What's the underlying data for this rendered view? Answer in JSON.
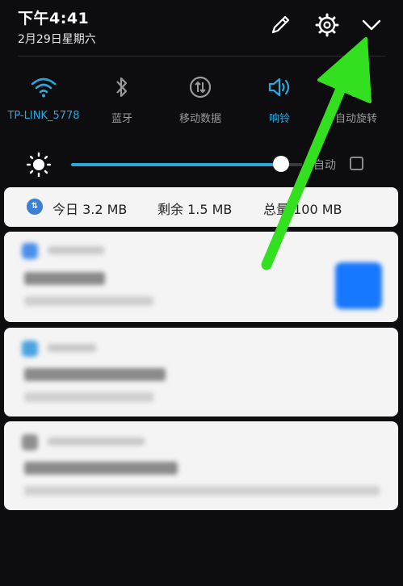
{
  "status": {
    "time": "下午4:41",
    "date": "2月29日星期六"
  },
  "header_icons": [
    "edit-icon",
    "settings-icon",
    "collapse-icon"
  ],
  "toggles": [
    {
      "label": "TP-LINK_5778",
      "icon": "wifi-icon",
      "state": "on"
    },
    {
      "label": "蓝牙",
      "icon": "bluetooth-icon",
      "state": "off"
    },
    {
      "label": "移动数据",
      "icon": "mobile-data-icon",
      "state": "off"
    },
    {
      "label": "响铃",
      "icon": "ringer-icon",
      "state": "on"
    },
    {
      "label": "自动旋转",
      "icon": "auto-rotate-icon",
      "state": "off"
    }
  ],
  "brightness": {
    "level": 0.92,
    "auto_label": "自动",
    "auto_checked": false
  },
  "data_usage": {
    "today": "今日 3.2 MB",
    "remaining": "剩余 1.5 MB",
    "total": "总量 100 MB"
  },
  "colors": {
    "accent": "#2aa7dc",
    "annotation_arrow": "#33e01f",
    "background": "#0d0d0f"
  }
}
